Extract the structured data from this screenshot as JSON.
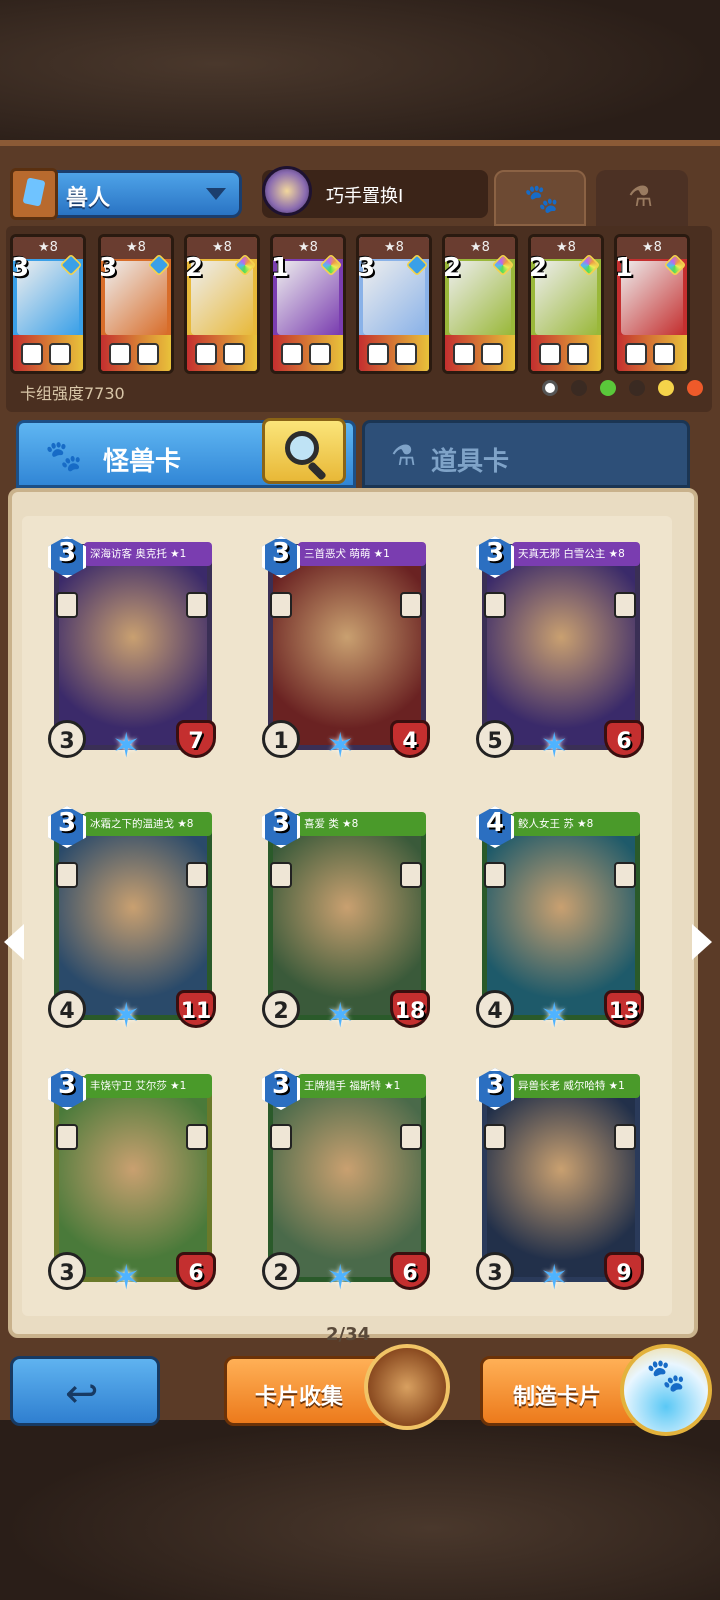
{
  "header": {
    "deck_name": "兽人",
    "skill_name": "巧手置换I"
  },
  "deck": {
    "cards": [
      {
        "stars": "★8",
        "cost": "3",
        "gem": "blue",
        "accent": "#3aa0e8"
      },
      {
        "stars": "★8",
        "cost": "3",
        "gem": "blue",
        "accent": "#d86d2a"
      },
      {
        "stars": "★8",
        "cost": "2",
        "gem": "rainbow",
        "accent": "#e8b93a"
      },
      {
        "stars": "★8",
        "cost": "1",
        "gem": "rainbow",
        "accent": "#7a3db0"
      },
      {
        "stars": "★8",
        "cost": "3",
        "gem": "blue",
        "accent": "#8ab2e8"
      },
      {
        "stars": "★8",
        "cost": "2",
        "gem": "rainbow",
        "accent": "#9ab83a"
      },
      {
        "stars": "★8",
        "cost": "2",
        "gem": "rainbow",
        "accent": "#9ab83a"
      },
      {
        "stars": "★8",
        "cost": "1",
        "gem": "rainbow",
        "accent": "#c42f2f"
      }
    ],
    "power_label": "卡组强度7730"
  },
  "categories": {
    "monster_label": "怪兽卡",
    "item_label": "道具卡"
  },
  "cards": [
    {
      "name": "深海访客 奥克托 ★1",
      "cost": "3",
      "atk": "3",
      "hp": "7",
      "banner": "#7a3db0",
      "frame": "#3a2f55",
      "art": "#3b2a6a"
    },
    {
      "name": "三首恶犬 萌萌 ★1",
      "cost": "3",
      "atk": "1",
      "hp": "4",
      "banner": "#7a3db0",
      "frame": "#3a2f55",
      "art": "#6a2222"
    },
    {
      "name": "天真无邪 白雪公主 ★8",
      "cost": "3",
      "atk": "5",
      "hp": "6",
      "banner": "#7a3db0",
      "frame": "#3a2f55",
      "art": "#3a2a6a"
    },
    {
      "name": "冰霜之下的温迪戈 ★8",
      "cost": "3",
      "atk": "4",
      "hp": "11",
      "banner": "#4a9a2a",
      "frame": "#2a5a2a",
      "art": "#2a4a6a"
    },
    {
      "name": "喜爱 类 ★8",
      "cost": "3",
      "atk": "2",
      "hp": "18",
      "banner": "#4a9a2a",
      "frame": "#2a5a2a",
      "art": "#3a5a3a"
    },
    {
      "name": "鲛人女王 苏 ★8",
      "cost": "4",
      "atk": "4",
      "hp": "13",
      "banner": "#4a9a2a",
      "frame": "#2a5a2a",
      "art": "#1e5a6a"
    },
    {
      "name": "丰饶守卫 艾尔莎 ★1",
      "cost": "3",
      "atk": "3",
      "hp": "6",
      "banner": "#4a9a2a",
      "frame": "#6a7a2a",
      "art": "#4a7a3a"
    },
    {
      "name": "王牌猎手 福斯特 ★1",
      "cost": "3",
      "atk": "2",
      "hp": "6",
      "banner": "#4a9a2a",
      "frame": "#2a5a2a",
      "art": "#4a6a4a"
    },
    {
      "name": "异兽长老 威尔哈特 ★1",
      "cost": "3",
      "atk": "3",
      "hp": "9",
      "banner": "#4a9a2a",
      "frame": "#2a3a5a",
      "art": "#22304a"
    }
  ],
  "pagination": {
    "text": "2/34"
  },
  "buttons": {
    "collect_label": "卡片收集",
    "craft_label": "制造卡片"
  }
}
